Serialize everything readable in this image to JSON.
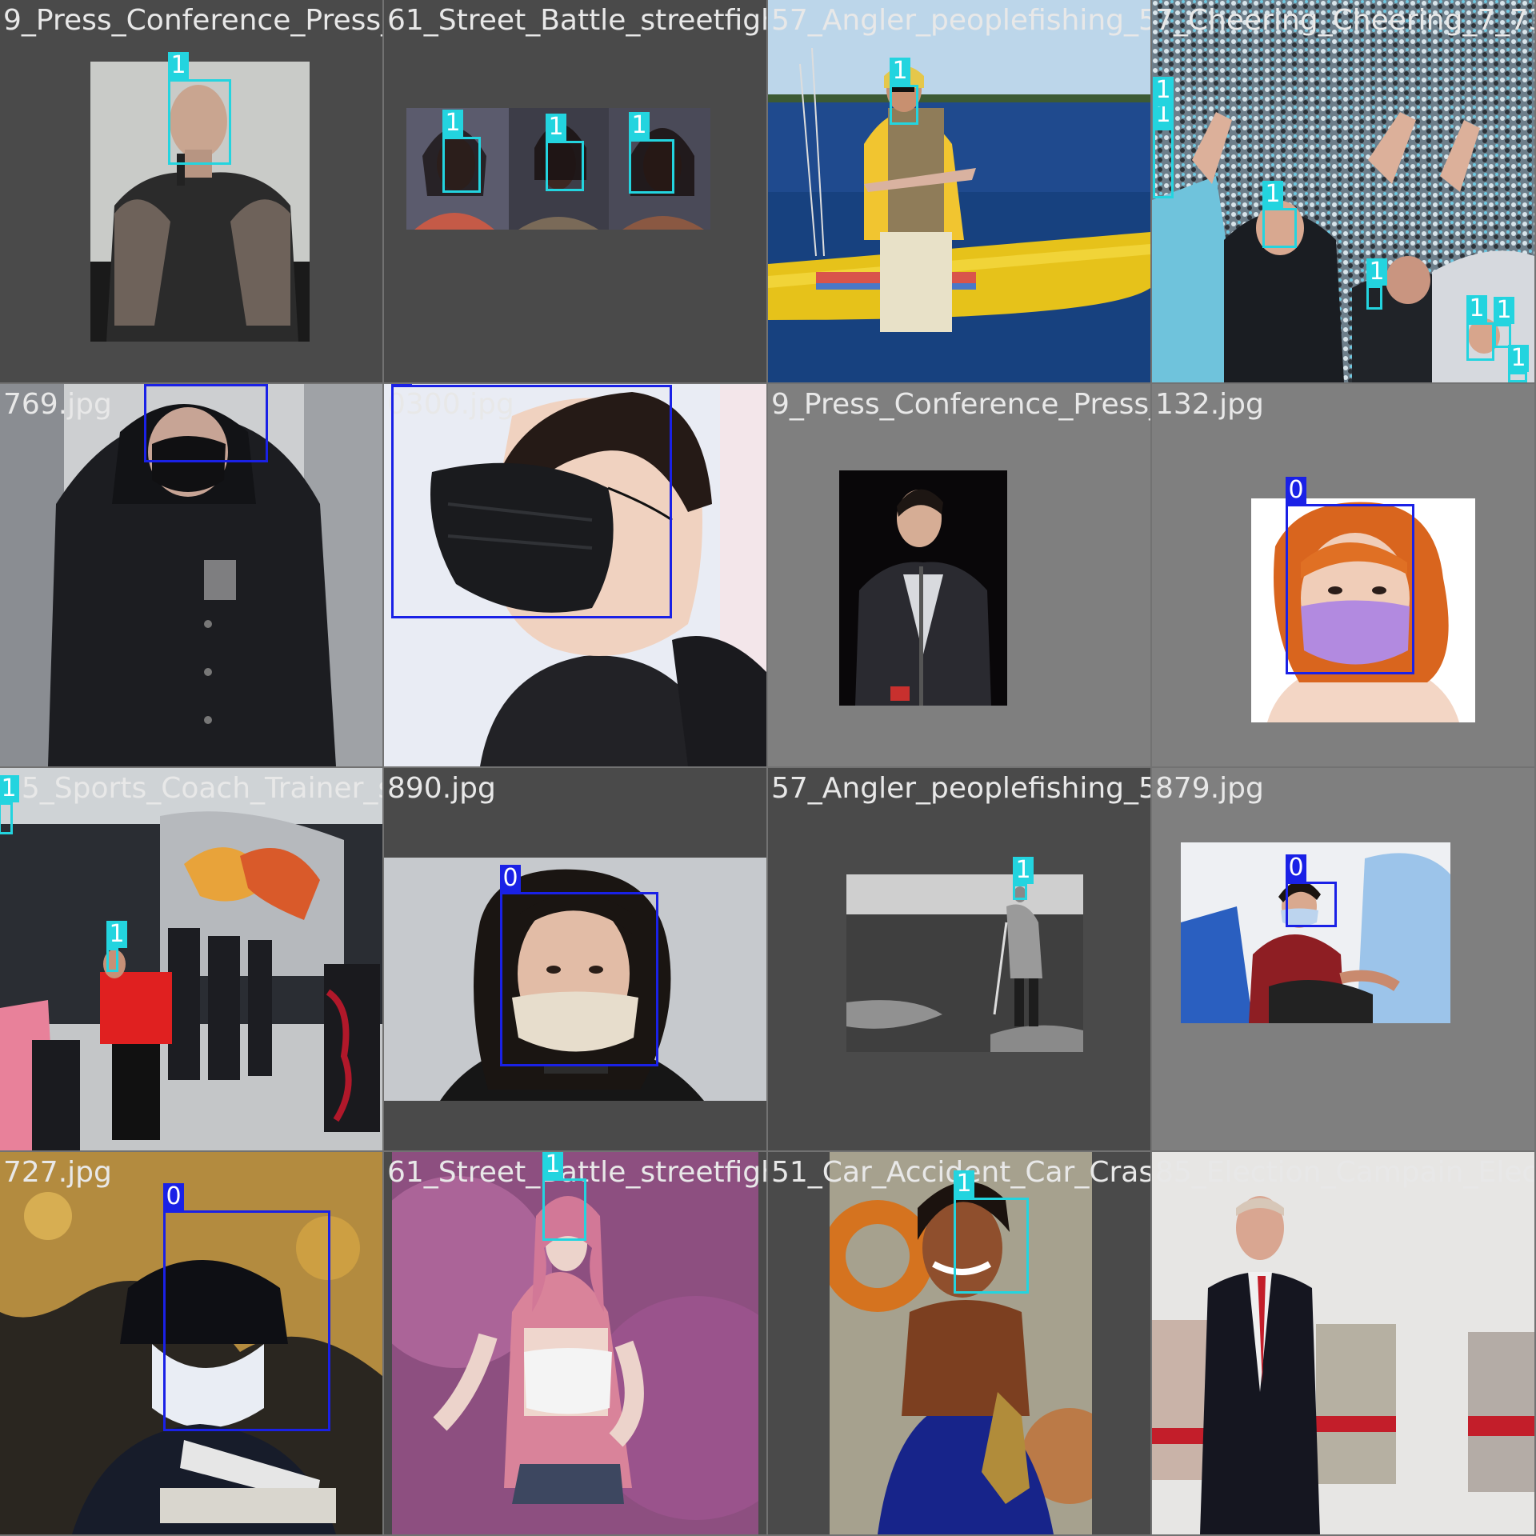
{
  "colors": {
    "class0": "#1a21e6",
    "class1": "#23d4df",
    "tile_bg_dark": "#4a4a4a",
    "tile_bg_mid": "#7f7f7f"
  },
  "tiles": [
    {
      "file": "9_Press_Conference_Press_Conference_9_67"
    },
    {
      "file": "61_Street_Battle_streetfight_61_343.jpg"
    },
    {
      "file": "57_Angler_peoplefishing_57_766.jpg"
    },
    {
      "file": "7_Cheering_Cheering_7_73"
    },
    {
      "file": "769.jpg"
    },
    {
      "file": "0300.jpg"
    },
    {
      "file": "9_Press_Conference_Press_Conference_9_92"
    },
    {
      "file": "132.jpg"
    },
    {
      "file": "55_Sports_Coach_Trainer_sportcoaching_55"
    },
    {
      "file": "890.jpg"
    },
    {
      "file": "57_Angler_peoplefishing_57_840.jpg"
    },
    {
      "file": "879.jpg"
    },
    {
      "file": "727.jpg"
    },
    {
      "file": "61_Street_Battle_streetfight_61_346.jpg"
    },
    {
      "file": "51_Car_Accident_Car_Crash_51_983.jpg"
    },
    {
      "file": "85_Election_Campain_Election"
    }
  ],
  "labels": {
    "class0": "0",
    "class1": "1"
  }
}
